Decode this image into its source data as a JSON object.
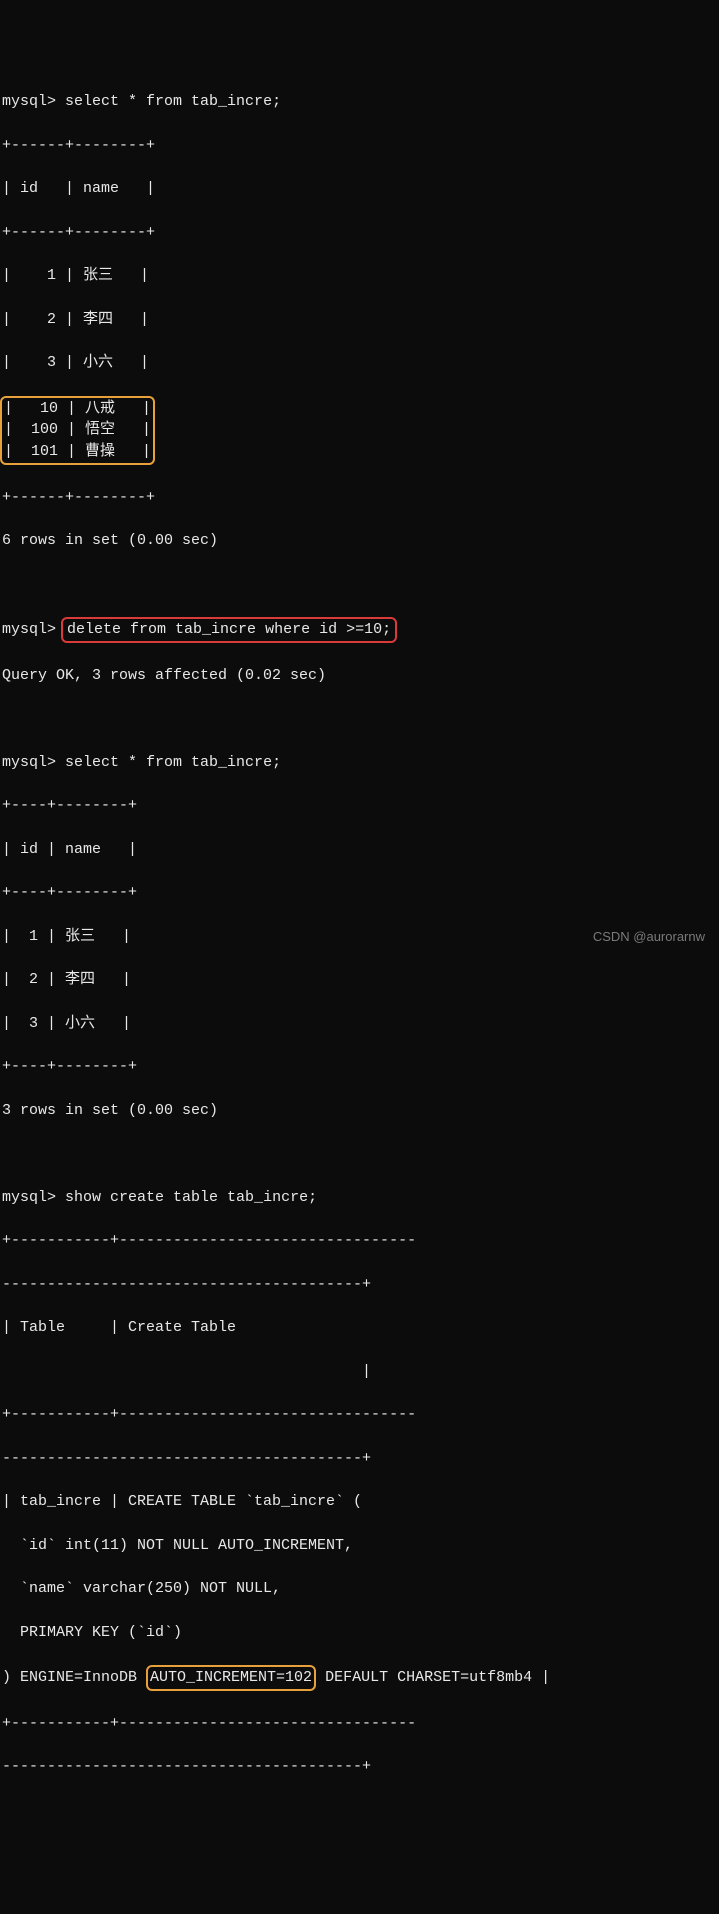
{
  "prompt": "mysql>",
  "query1": "select * from tab_incre;",
  "table1": {
    "sep_top": "+------+--------+",
    "header": "| id   | name   |",
    "sep_mid": "+------+--------+",
    "r1": "|    1 | 张三   |",
    "r2": "|    2 | 李四   |",
    "r3": "|    3 | 小六   |",
    "r4": "|   10 | 八戒   |",
    "r5": "|  100 | 悟空   |",
    "r6": "|  101 | 曹操   |",
    "sep_bot": "+------+--------+",
    "result": "6 rows in set (0.00 sec)"
  },
  "query2": "delete from tab_incre where id >=10;",
  "query2_result": "Query OK, 3 rows affected (0.02 sec)",
  "query3": "select * from tab_incre;",
  "table2": {
    "sep_top": "+----+--------+",
    "header": "| id | name   |",
    "sep_mid": "+----+--------+",
    "r1": "|  1 | 张三   |",
    "r2": "|  2 | 李四   |",
    "r3": "|  3 | 小六   |",
    "sep_bot": "+----+--------+",
    "result": "3 rows in set (0.00 sec)"
  },
  "query4": "show create table tab_incre;",
  "table3": {
    "sep_top": "+-----------+---------------------------------",
    "sep_top2": "----------------------------------------+",
    "header": "| Table     | Create Table                    ",
    "header2": "                                        |",
    "sep_mid": "+-----------+---------------------------------",
    "sep_mid2": "----------------------------------------+",
    "r1": "| tab_incre | CREATE TABLE `tab_incre` (",
    "r2": "  `id` int(11) NOT NULL AUTO_INCREMENT,",
    "r3": "  `name` varchar(250) NOT NULL,",
    "r4": "  PRIMARY KEY (`id`)",
    "r5a": ") ENGINE=InnoDB ",
    "r5b": "AUTO_INCREMENT=102",
    "r5c": " DEFAULT CHARSET=utf8mb4 |",
    "sep_bot": "+-----------+---------------------------------",
    "sep_bot2": "----------------------------------------+"
  },
  "watermark": "CSDN @aurorarnw"
}
